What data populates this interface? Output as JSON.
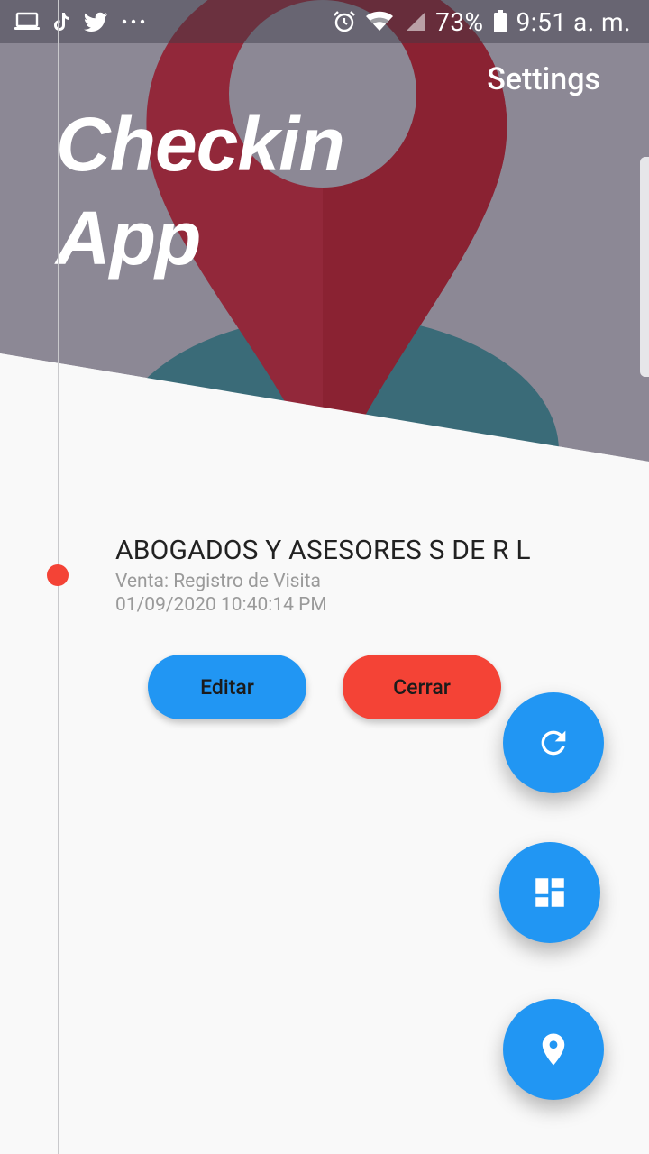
{
  "status_bar": {
    "battery": "73%",
    "time": "9:51 a. m.",
    "left_icons": [
      "laptop-icon",
      "tiktok-icon",
      "twitter-icon",
      "more-icon"
    ],
    "right_icons": [
      "alarm-icon",
      "wifi-icon",
      "signal-icon",
      "battery-icon"
    ]
  },
  "header": {
    "settings_label": "Settings",
    "title_line1": "Checkin",
    "title_line2": "App"
  },
  "entry": {
    "title": "ABOGADOS Y ASESORES S DE R L",
    "subtitle": "Venta: Registro de Visita",
    "datetime": "01/09/2020 10:40:14 PM"
  },
  "actions": {
    "edit_label": "Editar",
    "close_label": "Cerrar"
  },
  "fabs": [
    "refresh-icon",
    "dashboard-icon",
    "location-pin-icon"
  ],
  "colors": {
    "primary": "#2196f3",
    "danger": "#f44336",
    "header_overlay": "#8c8895",
    "pin_red": "#92283a",
    "teal": "#3a6b78"
  }
}
